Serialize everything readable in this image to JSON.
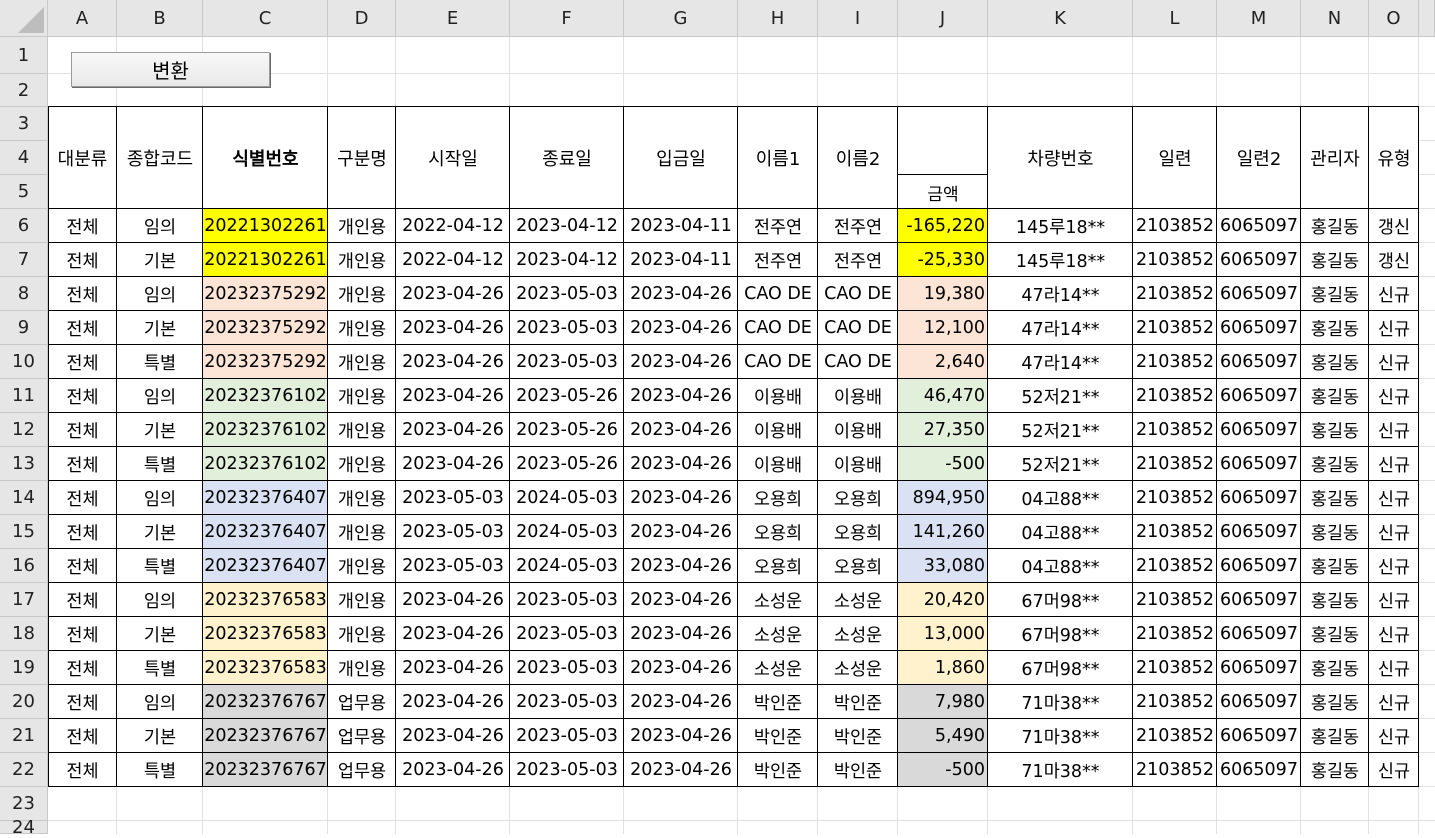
{
  "column_headers": [
    "A",
    "B",
    "C",
    "D",
    "E",
    "F",
    "G",
    "H",
    "I",
    "J",
    "K",
    "L",
    "M",
    "N",
    "O"
  ],
  "row_numbers": [
    "1",
    "2",
    "3",
    "4",
    "5",
    "6",
    "7",
    "8",
    "9",
    "10",
    "11",
    "12",
    "13",
    "14",
    "15",
    "16",
    "17",
    "18",
    "19",
    "20",
    "21",
    "22",
    "23",
    "24"
  ],
  "button": {
    "label": "변환"
  },
  "table_headers": [
    "대분류",
    "종합코드",
    "식별번호",
    "구분명",
    "시작일",
    "종료일",
    "입금일",
    "이름1",
    "이름2",
    "금액",
    "차량번호",
    "일련",
    "일련2",
    "관리자",
    "유형"
  ],
  "colors": {
    "yellow": "#ffff00",
    "peach": "#fce4d6",
    "green": "#e2efda",
    "blue": "#d9e1f2",
    "cream": "#fff2cc",
    "gray": "#d9d9d9"
  },
  "rows": [
    {
      "group": "yellow",
      "cells": [
        "전체",
        "임의",
        "20221302261",
        "개인용",
        "2022-04-12",
        "2023-04-12",
        "2023-04-11",
        "전주연",
        "전주연",
        "-165,220",
        "145루18**",
        "2103852",
        "6065097",
        "홍길동",
        "갱신"
      ]
    },
    {
      "group": "yellow",
      "cells": [
        "전체",
        "기본",
        "20221302261",
        "개인용",
        "2022-04-12",
        "2023-04-12",
        "2023-04-11",
        "전주연",
        "전주연",
        "-25,330",
        "145루18**",
        "2103852",
        "6065097",
        "홍길동",
        "갱신"
      ]
    },
    {
      "group": "peach",
      "cells": [
        "전체",
        "임의",
        "20232375292",
        "개인용",
        "2023-04-26",
        "2023-05-03",
        "2023-04-26",
        "CAO DE",
        "CAO DE",
        "19,380",
        "47라14**",
        "2103852",
        "6065097",
        "홍길동",
        "신규"
      ]
    },
    {
      "group": "peach",
      "cells": [
        "전체",
        "기본",
        "20232375292",
        "개인용",
        "2023-04-26",
        "2023-05-03",
        "2023-04-26",
        "CAO DE",
        "CAO DE",
        "12,100",
        "47라14**",
        "2103852",
        "6065097",
        "홍길동",
        "신규"
      ]
    },
    {
      "group": "peach",
      "cells": [
        "전체",
        "특별",
        "20232375292",
        "개인용",
        "2023-04-26",
        "2023-05-03",
        "2023-04-26",
        "CAO DE",
        "CAO DE",
        "2,640",
        "47라14**",
        "2103852",
        "6065097",
        "홍길동",
        "신규"
      ]
    },
    {
      "group": "green",
      "cells": [
        "전체",
        "임의",
        "20232376102",
        "개인용",
        "2023-04-26",
        "2023-05-26",
        "2023-04-26",
        "이용배",
        "이용배",
        "46,470",
        "52저21**",
        "2103852",
        "6065097",
        "홍길동",
        "신규"
      ]
    },
    {
      "group": "green",
      "cells": [
        "전체",
        "기본",
        "20232376102",
        "개인용",
        "2023-04-26",
        "2023-05-26",
        "2023-04-26",
        "이용배",
        "이용배",
        "27,350",
        "52저21**",
        "2103852",
        "6065097",
        "홍길동",
        "신규"
      ]
    },
    {
      "group": "green",
      "cells": [
        "전체",
        "특별",
        "20232376102",
        "개인용",
        "2023-04-26",
        "2023-05-26",
        "2023-04-26",
        "이용배",
        "이용배",
        "-500",
        "52저21**",
        "2103852",
        "6065097",
        "홍길동",
        "신규"
      ]
    },
    {
      "group": "blue",
      "cells": [
        "전체",
        "임의",
        "20232376407",
        "개인용",
        "2023-05-03",
        "2024-05-03",
        "2023-04-26",
        "오용희",
        "오용희",
        "894,950",
        "04고88**",
        "2103852",
        "6065097",
        "홍길동",
        "신규"
      ]
    },
    {
      "group": "blue",
      "cells": [
        "전체",
        "기본",
        "20232376407",
        "개인용",
        "2023-05-03",
        "2024-05-03",
        "2023-04-26",
        "오용희",
        "오용희",
        "141,260",
        "04고88**",
        "2103852",
        "6065097",
        "홍길동",
        "신규"
      ]
    },
    {
      "group": "blue",
      "cells": [
        "전체",
        "특별",
        "20232376407",
        "개인용",
        "2023-05-03",
        "2024-05-03",
        "2023-04-26",
        "오용희",
        "오용희",
        "33,080",
        "04고88**",
        "2103852",
        "6065097",
        "홍길동",
        "신규"
      ]
    },
    {
      "group": "cream",
      "cells": [
        "전체",
        "임의",
        "20232376583",
        "개인용",
        "2023-04-26",
        "2023-05-03",
        "2023-04-26",
        "소성운",
        "소성운",
        "20,420",
        "67머98**",
        "2103852",
        "6065097",
        "홍길동",
        "신규"
      ]
    },
    {
      "group": "cream",
      "cells": [
        "전체",
        "기본",
        "20232376583",
        "개인용",
        "2023-04-26",
        "2023-05-03",
        "2023-04-26",
        "소성운",
        "소성운",
        "13,000",
        "67머98**",
        "2103852",
        "6065097",
        "홍길동",
        "신규"
      ]
    },
    {
      "group": "cream",
      "cells": [
        "전체",
        "특별",
        "20232376583",
        "개인용",
        "2023-04-26",
        "2023-05-03",
        "2023-04-26",
        "소성운",
        "소성운",
        "1,860",
        "67머98**",
        "2103852",
        "6065097",
        "홍길동",
        "신규"
      ]
    },
    {
      "group": "gray",
      "cells": [
        "전체",
        "임의",
        "20232376767",
        "업무용",
        "2023-04-26",
        "2023-05-03",
        "2023-04-26",
        "박인준",
        "박인준",
        "7,980",
        "71마38**",
        "2103852",
        "6065097",
        "홍길동",
        "신규"
      ]
    },
    {
      "group": "gray",
      "cells": [
        "전체",
        "기본",
        "20232376767",
        "업무용",
        "2023-04-26",
        "2023-05-03",
        "2023-04-26",
        "박인준",
        "박인준",
        "5,490",
        "71마38**",
        "2103852",
        "6065097",
        "홍길동",
        "신규"
      ]
    },
    {
      "group": "gray",
      "cells": [
        "전체",
        "특별",
        "20232376767",
        "업무용",
        "2023-04-26",
        "2023-05-03",
        "2023-04-26",
        "박인준",
        "박인준",
        "-500",
        "71마38**",
        "2103852",
        "6065097",
        "홍길동",
        "신규"
      ]
    }
  ]
}
